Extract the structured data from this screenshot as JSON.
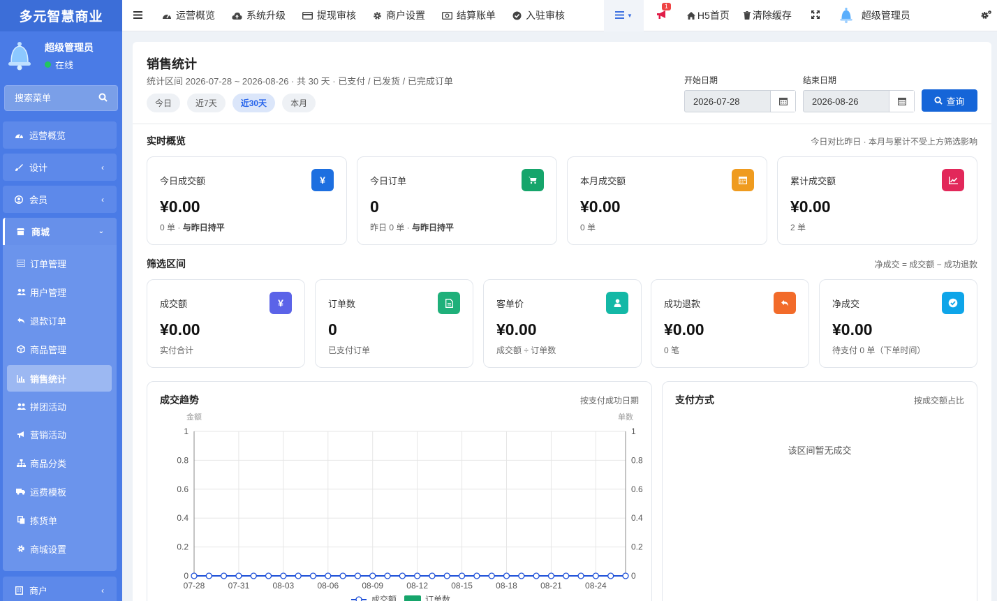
{
  "sidebar": {
    "brand": "多元智慧商业",
    "user": {
      "name": "超级管理员",
      "status": "在线"
    },
    "search_placeholder": "搜索菜单",
    "items": [
      {
        "label": "运营概览",
        "icon": "dashboard-icon"
      },
      {
        "label": "设计",
        "icon": "brush-icon",
        "expandable": true
      },
      {
        "label": "会员",
        "icon": "user-circle-icon",
        "expandable": true
      }
    ],
    "open_group": {
      "label": "商城",
      "icon": "shop-icon",
      "children": [
        {
          "label": "订单管理",
          "icon": "list-icon"
        },
        {
          "label": "用户管理",
          "icon": "users-icon"
        },
        {
          "label": "退款订单",
          "icon": "reply-icon"
        },
        {
          "label": "商品管理",
          "icon": "cube-icon"
        },
        {
          "label": "销售统计",
          "icon": "bar-chart-icon",
          "active": true
        },
        {
          "label": "拼团活动",
          "icon": "users-icon"
        },
        {
          "label": "营销活动",
          "icon": "bullhorn-icon"
        },
        {
          "label": "商品分类",
          "icon": "sitemap-icon"
        },
        {
          "label": "运费模板",
          "icon": "truck-icon"
        },
        {
          "label": "拣货单",
          "icon": "copy-icon"
        },
        {
          "label": "商城设置",
          "icon": "gear-icon"
        }
      ]
    },
    "bottom_item": {
      "label": "商户",
      "icon": "building-icon"
    }
  },
  "topbar": {
    "items": [
      {
        "label": "运营概览",
        "icon": "dashboard-icon"
      },
      {
        "label": "系统升级",
        "icon": "cloud-upload-icon"
      },
      {
        "label": "提现审核",
        "icon": "credit-card-icon"
      },
      {
        "label": "商户设置",
        "icon": "gear-icon"
      },
      {
        "label": "结算账单",
        "icon": "money-icon"
      },
      {
        "label": "入驻审核",
        "icon": "check-circle-icon"
      }
    ],
    "notification_count": "1",
    "h5_label": "H5首页",
    "clear_cache_label": "清除缓存",
    "admin_label": "超级管理员"
  },
  "page": {
    "title": "销售统计",
    "subtitle": "统计区间 2026-07-28 ~ 2026-08-26 · 共 30 天 · 已支付 / 已发货 / 已完成订单",
    "ranges": [
      {
        "label": "今日"
      },
      {
        "label": "近7天"
      },
      {
        "label": "近30天",
        "active": true
      },
      {
        "label": "本月"
      }
    ],
    "start_label": "开始日期",
    "start_value": "2026-07-28",
    "end_label": "结束日期",
    "end_value": "2026-08-26",
    "query_label": "查询"
  },
  "realtime": {
    "title": "实时概览",
    "note": "今日对比昨日 · 本月与累计不受上方筛选影响",
    "cards": [
      {
        "label": "今日成交额",
        "value": "¥0.00",
        "sub": "0 单 · ",
        "sub_bold": "与昨日持平",
        "icon": "yen-icon",
        "color": "#1d6fe0",
        "glyph": "¥"
      },
      {
        "label": "今日订单",
        "value": "0",
        "sub": "昨日 0 单 · ",
        "sub_bold": "与昨日持平",
        "icon": "cart-icon",
        "color": "#16a56b",
        "glyph": ""
      },
      {
        "label": "本月成交额",
        "value": "¥0.00",
        "sub": "0 单",
        "sub_bold": "",
        "icon": "calendar-icon",
        "color": "#ef9b1f",
        "glyph": ""
      },
      {
        "label": "累计成交额",
        "value": "¥0.00",
        "sub": "2 单",
        "sub_bold": "",
        "icon": "trend-icon",
        "color": "#e2285a",
        "glyph": ""
      }
    ]
  },
  "filtered": {
    "title": "筛选区间",
    "note": "净成交 = 成交额 − 成功退款",
    "cards": [
      {
        "label": "成交额",
        "value": "¥0.00",
        "sub": "实付合计",
        "icon": "yen-icon",
        "color": "#5b63e8",
        "glyph": "¥"
      },
      {
        "label": "订单数",
        "value": "0",
        "sub": "已支付订单",
        "icon": "file-icon",
        "color": "#1fb07a",
        "glyph": ""
      },
      {
        "label": "客单价",
        "value": "¥0.00",
        "sub": "成交额 ÷ 订单数",
        "icon": "user-icon",
        "color": "#14b8a6",
        "glyph": ""
      },
      {
        "label": "成功退款",
        "value": "¥0.00",
        "sub": "0 笔",
        "icon": "undo-icon",
        "color": "#f26b2a",
        "glyph": ""
      },
      {
        "label": "净成交",
        "value": "¥0.00",
        "sub": "待支付 0 单（下单时间）",
        "icon": "check-badge-icon",
        "color": "#0ea5e9",
        "glyph": ""
      }
    ]
  },
  "trend": {
    "title": "成交趋势",
    "note": "按支付成功日期"
  },
  "payment": {
    "title": "支付方式",
    "note": "按成交额占比",
    "empty": "该区间暂无成交"
  },
  "chart_data": {
    "type": "line",
    "title": "",
    "left_axis_label": "金额",
    "right_axis_label": "单数",
    "ylim": [
      0,
      1
    ],
    "yticks": [
      "0",
      "0.2",
      "0.4",
      "0.6",
      "0.8",
      "1"
    ],
    "x": [
      "07-28",
      "07-29",
      "07-30",
      "07-31",
      "08-01",
      "08-02",
      "08-03",
      "08-04",
      "08-05",
      "08-06",
      "08-07",
      "08-08",
      "08-09",
      "08-10",
      "08-11",
      "08-12",
      "08-13",
      "08-14",
      "08-15",
      "08-16",
      "08-17",
      "08-18",
      "08-19",
      "08-20",
      "08-21",
      "08-22",
      "08-23",
      "08-24",
      "08-25",
      "08-26"
    ],
    "xtick_labels": [
      "07-28",
      "07-31",
      "08-03",
      "08-06",
      "08-09",
      "08-12",
      "08-15",
      "08-18",
      "08-21",
      "08-24"
    ],
    "series": [
      {
        "name": "成交额",
        "type": "line",
        "color": "#1d4fd8",
        "values": [
          0,
          0,
          0,
          0,
          0,
          0,
          0,
          0,
          0,
          0,
          0,
          0,
          0,
          0,
          0,
          0,
          0,
          0,
          0,
          0,
          0,
          0,
          0,
          0,
          0,
          0,
          0,
          0,
          0,
          0
        ]
      },
      {
        "name": "订单数",
        "type": "bar",
        "color": "#16a56b",
        "values": [
          0,
          0,
          0,
          0,
          0,
          0,
          0,
          0,
          0,
          0,
          0,
          0,
          0,
          0,
          0,
          0,
          0,
          0,
          0,
          0,
          0,
          0,
          0,
          0,
          0,
          0,
          0,
          0,
          0,
          0
        ]
      }
    ],
    "grid": true,
    "legend": "bottom"
  }
}
